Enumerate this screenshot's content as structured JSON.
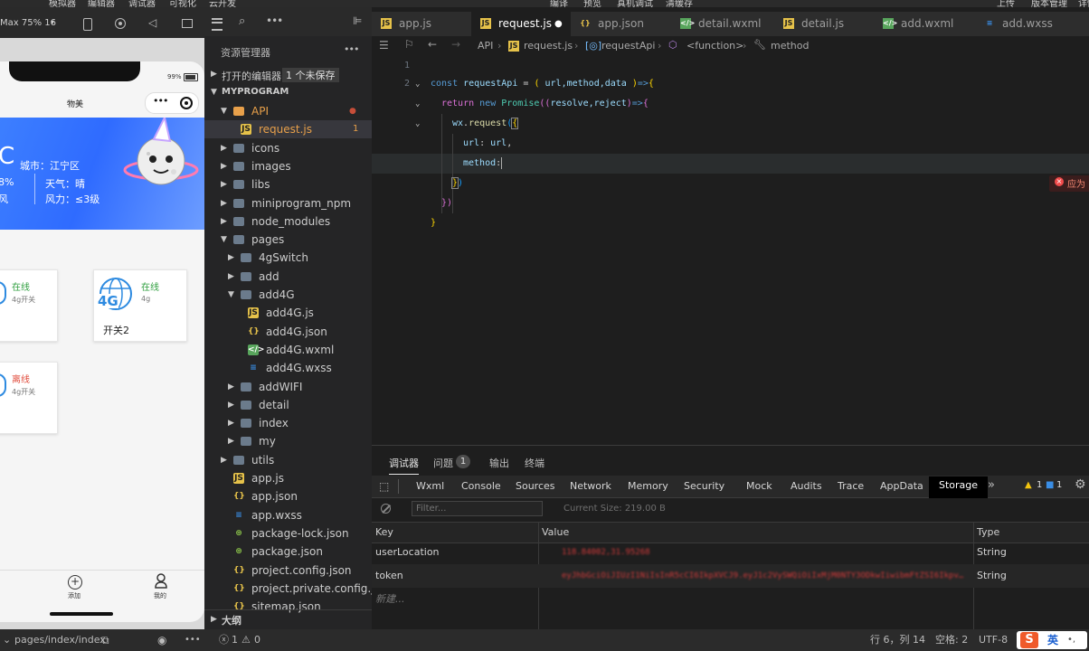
{
  "top_menu": {
    "left_items": [
      "模拟器",
      "编辑器",
      "调试器",
      "可视化",
      "云开发"
    ],
    "center_items": [
      "编译",
      "预览",
      "真机调试",
      "清缓存"
    ],
    "right_items": [
      "上传",
      "版本管理",
      "详情"
    ]
  },
  "simulator": {
    "device": "Max 75% 16",
    "page_title": "物美",
    "weather": {
      "temp_unit": "C",
      "city": "城市：江宁区",
      "humidity": "8%",
      "weather": "天气：晴",
      "wind_dir": "风",
      "wind": "风力：≤3级"
    },
    "battery": "99%",
    "devices": [
      {
        "status": "在线",
        "type": "4g开关",
        "name": "",
        "state_color": "#2e9e3e"
      },
      {
        "status": "在线",
        "type": "4g",
        "name": "开关2",
        "badge": "4G",
        "state_color": "#2e9e3e"
      },
      {
        "status": "离线",
        "type": "4g开关",
        "name": "",
        "state_color": "#e04a3a"
      }
    ],
    "nav": {
      "add": "添加",
      "mine": "我的"
    }
  },
  "explorer": {
    "title": "资源管理器",
    "open_editors": "打开的编辑器",
    "unsaved": "1 个未保存",
    "project": "MYPROGRAM",
    "items": [
      {
        "label": "API",
        "depth": 1,
        "kind": "folder-open",
        "color": "#e8a04a",
        "mod": true
      },
      {
        "label": "request.js",
        "depth": 2,
        "kind": "js",
        "badge": "1",
        "selected": true
      },
      {
        "label": "icons",
        "depth": 1,
        "kind": "folder"
      },
      {
        "label": "images",
        "depth": 1,
        "kind": "folder"
      },
      {
        "label": "libs",
        "depth": 1,
        "kind": "folder"
      },
      {
        "label": "miniprogram_npm",
        "depth": 1,
        "kind": "folder"
      },
      {
        "label": "node_modules",
        "depth": 1,
        "kind": "folder"
      },
      {
        "label": "pages",
        "depth": 1,
        "kind": "folder-open"
      },
      {
        "label": "4gSwitch",
        "depth": 2,
        "kind": "folder"
      },
      {
        "label": "add",
        "depth": 2,
        "kind": "folder"
      },
      {
        "label": "add4G",
        "depth": 2,
        "kind": "folder-open"
      },
      {
        "label": "add4G.js",
        "depth": 3,
        "kind": "js"
      },
      {
        "label": "add4G.json",
        "depth": 3,
        "kind": "json"
      },
      {
        "label": "add4G.wxml",
        "depth": 3,
        "kind": "wxml"
      },
      {
        "label": "add4G.wxss",
        "depth": 3,
        "kind": "wxss"
      },
      {
        "label": "addWIFI",
        "depth": 2,
        "kind": "folder"
      },
      {
        "label": "detail",
        "depth": 2,
        "kind": "folder"
      },
      {
        "label": "index",
        "depth": 2,
        "kind": "folder"
      },
      {
        "label": "my",
        "depth": 2,
        "kind": "folder"
      },
      {
        "label": "utils",
        "depth": 1,
        "kind": "folder"
      },
      {
        "label": "app.js",
        "depth": 1,
        "kind": "js"
      },
      {
        "label": "app.json",
        "depth": 1,
        "kind": "json"
      },
      {
        "label": "app.wxss",
        "depth": 1,
        "kind": "wxss"
      },
      {
        "label": "package-lock.json",
        "depth": 1,
        "kind": "pkg"
      },
      {
        "label": "package.json",
        "depth": 1,
        "kind": "pkg"
      },
      {
        "label": "project.config.json",
        "depth": 1,
        "kind": "json"
      },
      {
        "label": "project.private.config.js...",
        "depth": 1,
        "kind": "json"
      },
      {
        "label": "sitemap.json",
        "depth": 1,
        "kind": "json"
      }
    ],
    "outline": "大纲"
  },
  "tabs": [
    {
      "label": "app.js",
      "kind": "js"
    },
    {
      "label": "request.js",
      "kind": "js",
      "active": true,
      "dirty": true
    },
    {
      "label": "app.json",
      "kind": "json"
    },
    {
      "label": "detail.wxml",
      "kind": "wxml"
    },
    {
      "label": "detail.js",
      "kind": "js"
    },
    {
      "label": "add.wxml",
      "kind": "wxml"
    },
    {
      "label": "add.wxss",
      "kind": "wxss"
    }
  ],
  "breadcrumb": [
    "API",
    "request.js",
    "requestApi",
    "<function>",
    "method"
  ],
  "code": {
    "line1": {
      "kw": "const",
      "name": "requestApi",
      "eq": "=",
      "p1": "(",
      "args": " url,method,data ",
      "p2": ")",
      "arrow": "=>",
      "brace": "{"
    },
    "line2": {
      "kw": "return",
      "kw2": "new",
      "cls": "Promise",
      "p": "((",
      "args": "resolve,reject",
      "p2": ")",
      "arrow": "=>",
      "brace": "{"
    },
    "line3": {
      "obj": "wx",
      "dot": ".",
      "fn": "request",
      "p": "(",
      "brace": "{"
    },
    "line4": {
      "key": "url",
      "colon": ":",
      "val": "url",
      "comma": ","
    },
    "line5": {
      "key": "method",
      "colon": ":"
    },
    "line6": {
      "brace": "}",
      "p": ")"
    },
    "line7": {
      "text": "})"
    },
    "line8": {
      "text": "}"
    },
    "error_hint": "应为"
  },
  "panel": {
    "tabs": [
      "调试器",
      "问题",
      "输出",
      "终端"
    ],
    "problems_count": "1",
    "devtools_tabs": [
      "Wxml",
      "Console",
      "Sources",
      "Network",
      "Memory",
      "Security",
      "Mock",
      "Audits",
      "Trace",
      "AppData",
      "Storage"
    ],
    "warn_count": "1",
    "info_count": "1",
    "filter_placeholder": "Filter...",
    "current_size": "Current Size:  219.00 B",
    "columns": [
      "Key",
      "Value",
      "Type"
    ],
    "rows": [
      {
        "key": "userLocation",
        "value": "118.84002,31.95268",
        "type": "String"
      },
      {
        "key": "token",
        "value": "eyJhbGciOiJIUzI1NiIsInR5cCI6IkpXVCJ9.eyJ1c2VySWQiOiIxMjM0NTY3ODkwIiwibmFtZSI6IkpvaG4gRG9lIiwiaWF0IjoxNTE2MjM5MDIyfQ",
        "type": "String"
      }
    ],
    "new_row": "新建..."
  },
  "status": {
    "path": "pages/index/index",
    "errors": "1",
    "warnings": "0",
    "line_col": "行 6，列 14",
    "spaces": "空格: 2",
    "encoding": "UTF-8",
    "ime": "英"
  }
}
